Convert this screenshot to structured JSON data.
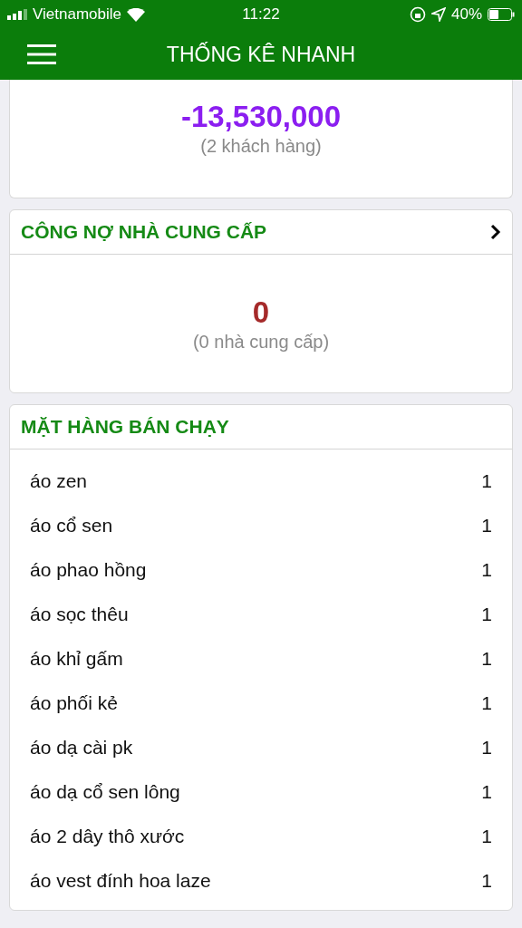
{
  "status_bar": {
    "carrier": "Vietnamobile",
    "time": "11:22",
    "battery": "40%"
  },
  "header": {
    "title": "THỐNG KÊ NHANH"
  },
  "customer_debt": {
    "value": "-13,530,000",
    "subtitle": "(2 khách hàng)"
  },
  "supplier_debt": {
    "title": "CÔNG NỢ NHÀ CUNG CẤP",
    "value": "0",
    "subtitle": "(0 nhà cung cấp)"
  },
  "best_sellers": {
    "title": "MẶT HÀNG BÁN CHẠY",
    "items": [
      {
        "name": "áo zen",
        "count": "1"
      },
      {
        "name": "áo cổ sen",
        "count": "1"
      },
      {
        "name": "áo phao hồng",
        "count": "1"
      },
      {
        "name": "áo sọc thêu",
        "count": "1"
      },
      {
        "name": "áo khỉ gấm",
        "count": "1"
      },
      {
        "name": "áo phối kẻ",
        "count": "1"
      },
      {
        "name": "áo dạ cài pk",
        "count": "1"
      },
      {
        "name": "áo dạ cổ sen lông",
        "count": "1"
      },
      {
        "name": "áo 2 dây thô xước",
        "count": "1"
      },
      {
        "name": "áo vest đính hoa laze",
        "count": "1"
      }
    ]
  }
}
